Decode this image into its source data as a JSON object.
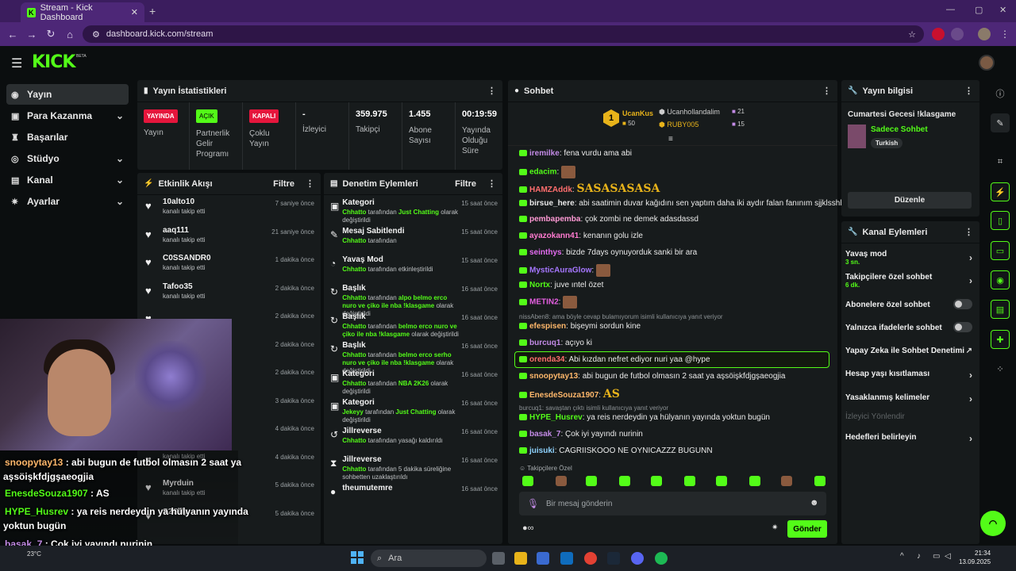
{
  "browser": {
    "tab_title": "Stream - Kick Dashboard",
    "url": "dashboard.kick.com/stream"
  },
  "header": {
    "logo": "KICK",
    "beta": "BETA"
  },
  "sidebar": {
    "items": [
      {
        "label": "Yayın",
        "icon": "broadcast-icon"
      },
      {
        "label": "Para Kazanma",
        "icon": "money-icon"
      },
      {
        "label": "Başarılar",
        "icon": "trophy-icon"
      },
      {
        "label": "Stüdyo",
        "icon": "studio-icon"
      },
      {
        "label": "Kanal",
        "icon": "channel-icon"
      },
      {
        "label": "Ayarlar",
        "icon": "gear-icon"
      }
    ]
  },
  "stats": {
    "title": "Yayın İstatistikleri",
    "live_badge": "YAYINDA",
    "live_label": "Yayın",
    "partner_badge": "AÇIK",
    "partner_label": "Partnerlik Gelir Programı",
    "multi_badge": "KAPALI",
    "multi_label": "Çoklu Yayın",
    "viewers": "-",
    "viewers_label": "İzleyici",
    "followers": "359.975",
    "followers_label": "Takipçi",
    "subs": "1.455",
    "subs_label": "Abone Sayısı",
    "uptime": "00:19:59",
    "uptime_label": "Yayında Olduğu Süre"
  },
  "activity": {
    "title": "Etkinlik Akışı",
    "filter": "Filtre",
    "rows": [
      {
        "name": "10alto10",
        "sub": "kanalı takip etti",
        "time": "7 saniye önce"
      },
      {
        "name": "aaq111",
        "sub": "kanalı takip etti",
        "time": "21 saniye önce"
      },
      {
        "name": "C0SSANDR0",
        "sub": "kanalı takip etti",
        "time": "1 dakika önce"
      },
      {
        "name": "Tafoo35",
        "sub": "kanalı takip etti",
        "time": "2 dakika önce"
      },
      {
        "name": "",
        "sub": "",
        "time": "2 dakika önce"
      },
      {
        "name": "",
        "sub": "",
        "time": "2 dakika önce"
      },
      {
        "name": "",
        "sub": "",
        "time": "2 dakika önce"
      },
      {
        "name": "",
        "sub": "",
        "time": "3 dakika önce"
      },
      {
        "name": "",
        "sub": "",
        "time": "4 dakika önce"
      },
      {
        "name": "",
        "sub": "kanalı takip etti",
        "time": "4 dakika önce"
      },
      {
        "name": "Myrduin",
        "sub": "kanalı takip etti",
        "time": "5 dakika önce"
      },
      {
        "name": "S2Gfly",
        "sub": "",
        "time": "5 dakika önce"
      }
    ]
  },
  "moderation": {
    "title": "Denetim Eylemleri",
    "filter": "Filtre",
    "rows": [
      {
        "title": "Kategori",
        "user": "Chhatto",
        "pre": " tarafından ",
        "hl": "Just Chatting",
        "post": " olarak değiştirildi",
        "time": "15 saat önce",
        "icon": "category-icon"
      },
      {
        "title": "Mesaj Sabitlendi",
        "user": "Chhatto",
        "pre": " tarafından",
        "hl": "",
        "post": "",
        "time": "15 saat önce",
        "icon": "pin-icon"
      },
      {
        "title": "Yavaş Mod",
        "user": "Chhatto",
        "pre": " tarafından etkinleştirildi",
        "hl": "",
        "post": "",
        "time": "15 saat önce",
        "icon": "slow-mode-icon"
      },
      {
        "title": "Başlık",
        "user": "Chhatto",
        "pre": " tarafından ",
        "hl": "alpo belmo erco nuro ve çiko ile nba !klasgame",
        "post": " olarak değiştirildi",
        "time": "16 saat önce",
        "icon": "title-icon"
      },
      {
        "title": "Başlık",
        "user": "Chhatto",
        "pre": " tarafından ",
        "hl": "belmo erco nuro ve çiko ile nba !klasgame",
        "post": " olarak değiştirildi",
        "time": "16 saat önce",
        "icon": "title-icon"
      },
      {
        "title": "Başlık",
        "user": "Chhatto",
        "pre": " tarafından ",
        "hl": "belmo erco serho nuro ve çiko ile nba !klasgame",
        "post": " olarak değiştirildi",
        "time": "16 saat önce",
        "icon": "title-icon"
      },
      {
        "title": "Kategori",
        "user": "Chhatto",
        "pre": " tarafından ",
        "hl": "NBA 2K26",
        "post": " olarak değiştirildi",
        "time": "16 saat önce",
        "icon": "category-icon"
      },
      {
        "title": "Kategori",
        "user": "Jekeyy",
        "pre": " tarafından ",
        "hl": "Just Chatting",
        "post": " olarak değiştirildi",
        "time": "16 saat önce",
        "icon": "category-icon"
      },
      {
        "title": "Jillreverse",
        "user": "Chhatto",
        "pre": " tarafından yasağı kaldırıldı",
        "hl": "",
        "post": "",
        "time": "16 saat önce",
        "icon": "unban-icon"
      },
      {
        "title": "Jillreverse",
        "user": "Chhatto",
        "pre": " tarafından 5 dakika süreliğine sohbetten uzaklaştırıldı",
        "hl": "",
        "post": "",
        "time": "16 saat önce",
        "icon": "timeout-icon"
      },
      {
        "title": "theumutemre",
        "user": "",
        "pre": "",
        "hl": "",
        "post": "",
        "time": "16 saat önce",
        "icon": "user-icon"
      }
    ]
  },
  "chat": {
    "title": "Sohbet",
    "pin_rank": "1",
    "pin_user1": "UcanKus",
    "pin_amt1": "50",
    "pin_user2": "Ucanhollandalim",
    "pin_amt2": "21",
    "pin_user3": "RUBY005",
    "pin_amt3": "15",
    "messages": [
      {
        "user": "iremilke",
        "color": "#c38be6",
        "text": ": fena vurdu ama abi"
      },
      {
        "user": "edacim",
        "color": "#53fc18",
        "text": ":"
      },
      {
        "user": "HAMZAddk",
        "color": "#ff6e6e",
        "text": ":",
        "emote_text": "SASASASASA"
      },
      {
        "user": "birsue_here",
        "color": "#eaeaea",
        "text": ": abi saatimin duvar kağıdını sen yaptım daha iki aydır falan fanınım sjjklsshhgj"
      },
      {
        "user": "pembapemba",
        "color": "#ff9ad5",
        "text": ": çok zombi ne demek adasdassd"
      },
      {
        "user": "ayazokann41",
        "color": "#ff7bd0",
        "text": ": kenanın golu izle"
      },
      {
        "user": "seinthys",
        "color": "#e36cf0",
        "text": ": bizde 7days oynuyorduk sanki bir ara"
      },
      {
        "user": "MysticAuraGlow",
        "color": "#a677ff",
        "text": ":"
      },
      {
        "user": "Nortx",
        "color": "#53fc18",
        "text": ": juve ıntel özet"
      },
      {
        "user": "METIN2",
        "color": "#e65fe2",
        "text": ":"
      },
      {
        "reply": "nissAben8: ama böyle cevap bulamıyorum isimli kullanıcıya yanıt veriyor"
      },
      {
        "user": "efespisen",
        "color": "#ffb86b",
        "text": ": bişeymi sordun kine"
      },
      {
        "user": "burcuq1",
        "color": "#c38be6",
        "text": ": açıyo ki"
      },
      {
        "user": "orenda34",
        "color": "#ff6e6e",
        "text": ": Abi kızdan nefret ediyor nuri yaa @hype"
      },
      {
        "user": "snoopytay13",
        "color": "#ffb86b",
        "text": ": abi bugun de futbol olmasın 2 saat ya aşsöişkfdjgşaeogjia"
      },
      {
        "user": "EnesdeSouza1907",
        "color": "#ffb86b",
        "text": ":",
        "emote_text": "AS"
      },
      {
        "reply": "burcuq1: savaştan çıktı isimli kullanıcıya yanıt veriyor"
      },
      {
        "user": "HYPE_Husrev",
        "color": "#53fc18",
        "text": ": ya reis nerdeydin ya hülyanın yayında yoktun bugün"
      },
      {
        "user": "basak_7",
        "color": "#c38be6",
        "text": ": Çok iyi yayındı nurinin"
      },
      {
        "user": "juisuki",
        "color": "#8fd3ff",
        "text": ": CAGRIISKOOO NE OYNICAZZZ BUGUNN"
      }
    ],
    "followers_only": "Takipçilere Özel",
    "input_placeholder": "Bir mesaj gönderin",
    "send": "Gönder"
  },
  "info": {
    "title": "Yayın bilgisi",
    "stream_title": "Cumartesi Gecesi !klasgame",
    "category": "Sadece Sohbet",
    "tag": "Turkish",
    "edit": "Düzenle"
  },
  "channel_actions": {
    "title": "Kanal Eylemleri",
    "slow_mode": "Yavaş mod",
    "slow_sub": "3 sn.",
    "followers_only": "Takipçilere özel sohbet",
    "followers_sub": "6 dk.",
    "subs_only": "Abonelere özel sohbet",
    "emote_only": "Yalnızca ifadelerle sohbet",
    "ai_mod": "Yapay Zeka ile Sohbet Denetimi",
    "age": "Hesap yaşı kısıtlaması",
    "banned_words": "Yasaklanmış kelimeler",
    "raid": "İzleyici Yönlendir",
    "goals": "Hedefleri belirleyin"
  },
  "overlay": {
    "lines": [
      {
        "user": "snoopytay13",
        "text": " : abi bugun de futbol olmasın 2 saat ya",
        "color": "#ffb86b"
      },
      {
        "user": "",
        "text": "aşsöişkfdjgşaeogjia",
        "color": "#fff"
      },
      {
        "user": "EnesdeSouza1907",
        "text": " : AS",
        "color": "#53fc18"
      },
      {
        "user": "HYPE_Husrev",
        "text": " : ya reis nerdeydin ya hülyanın yayında",
        "color": "#53fc18"
      },
      {
        "user": "",
        "text": "yoktun bugün",
        "color": "#fff"
      },
      {
        "user": "basak_7",
        "text": " : Çok iyi yayındı nurinin",
        "color": "#c38be6"
      },
      {
        "user": "juisuki",
        "text": " : CAGRIISKOOO NE OYNICAZZZ BUGUNN",
        "color": "#fff"
      }
    ]
  },
  "taskbar": {
    "search": "Ara",
    "temp": "23°C",
    "time": "21:34",
    "date": "13.09.2025"
  }
}
